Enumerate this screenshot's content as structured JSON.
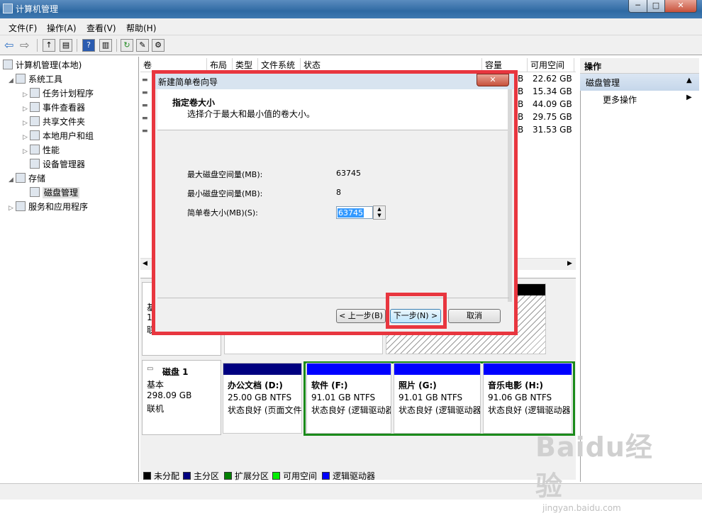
{
  "window": {
    "title": "计算机管理",
    "min": "─",
    "max": "□",
    "close": "✕"
  },
  "menu": [
    "文件(F)",
    "操作(A)",
    "查看(V)",
    "帮助(H)"
  ],
  "tree": {
    "root": "计算机管理(本地)",
    "system_tools": "系统工具",
    "task_scheduler": "任务计划程序",
    "event_viewer": "事件查看器",
    "shared_folders": "共享文件夹",
    "local_users": "本地用户和组",
    "performance": "性能",
    "device_manager": "设备管理器",
    "storage": "存储",
    "disk_management": "磁盘管理",
    "services_apps": "服务和应用程序"
  },
  "columns": [
    "卷",
    "布局",
    "类型",
    "文件系统",
    "状态",
    "容量",
    "可用空间"
  ],
  "free_space": [
    "22.62 GB",
    "15.34 GB",
    "44.09 GB",
    "29.75 GB",
    "31.53 GB"
  ],
  "cap_suffix": "B",
  "disk0_fragments": [
    "基",
    "1",
    "联"
  ],
  "disk1": {
    "name": "磁盘 1",
    "type": "基本",
    "size": "298.09 GB",
    "status": "联机"
  },
  "partitions": [
    {
      "name": "办公文档  (D:)",
      "size": "25.00 GB NTFS",
      "status": "状态良好 (页面文件"
    },
    {
      "name": "软件  (F:)",
      "size": "91.01 GB NTFS",
      "status": "状态良好 (逻辑驱动器"
    },
    {
      "name": "照片  (G:)",
      "size": "91.01 GB NTFS",
      "status": "状态良好 (逻辑驱动器"
    },
    {
      "name": "音乐电影  (H:)",
      "size": "91.06 GB NTFS",
      "status": "状态良好 (逻辑驱动器"
    }
  ],
  "legend": [
    "未分配",
    "主分区",
    "扩展分区",
    "可用空间",
    "逻辑驱动器"
  ],
  "legend_colors": [
    "#000000",
    "#000080",
    "#008000",
    "#00ee00",
    "#0000ff"
  ],
  "actions": {
    "header": "操作",
    "section": "磁盘管理",
    "more": "更多操作"
  },
  "dialog": {
    "title": "新建简单卷向导",
    "heading": "指定卷大小",
    "subheading": "选择介于最大和最小值的卷大小。",
    "max_label": "最大磁盘空间量(MB):",
    "max_value": "63745",
    "min_label": "最小磁盘空间量(MB):",
    "min_value": "8",
    "size_label": "简单卷大小(MB)(S):",
    "size_value": "63745",
    "back": "< 上一步(B)",
    "next": "下一步(N) >",
    "cancel": "取消"
  },
  "watermark": {
    "logo": "Baidu经验",
    "url": "jingyan.baidu.com"
  }
}
